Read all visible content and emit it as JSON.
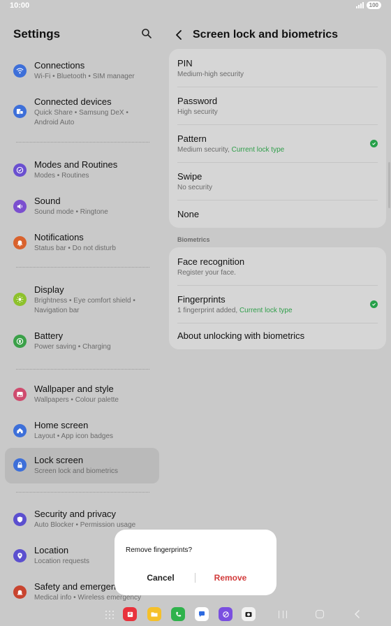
{
  "status_bar": {
    "time": "10:00",
    "battery": "100"
  },
  "left": {
    "title": "Settings",
    "items": [
      {
        "title": "Connections",
        "sub": "Wi-Fi  •  Bluetooth  •  SIM manager",
        "icon": "wifi-icon",
        "color": "#3d6fd9"
      },
      {
        "title": "Connected devices",
        "sub": "Quick Share  •  Samsung DeX  •",
        "sub2": "Android Auto",
        "icon": "devices-icon",
        "color": "#3d6fd9"
      },
      {
        "title": "Modes and Routines",
        "sub": "Modes  •  Routines",
        "icon": "routines-icon",
        "color": "#6a4fd0"
      },
      {
        "title": "Sound",
        "sub": "Sound mode  •  Ringtone",
        "icon": "sound-icon",
        "color": "#7b4fcf"
      },
      {
        "title": "Notifications",
        "sub": "Status bar  •  Do not disturb",
        "icon": "bell-icon",
        "color": "#d9622d"
      },
      {
        "title": "Display",
        "sub": "Brightness  •  Eye comfort shield  •",
        "sub2": "Navigation bar",
        "icon": "sun-icon",
        "color": "#8dc12b"
      },
      {
        "title": "Battery",
        "sub": "Power saving  •  Charging",
        "icon": "battery-icon",
        "color": "#3aa048"
      },
      {
        "title": "Wallpaper and style",
        "sub": "Wallpapers  •  Colour palette",
        "icon": "wallpaper-icon",
        "color": "#cf4b6e"
      },
      {
        "title": "Home screen",
        "sub": "Layout  •  App icon badges",
        "icon": "home-icon",
        "color": "#3d6fd9"
      },
      {
        "title": "Lock screen",
        "sub": "Screen lock and biometrics",
        "icon": "lock-icon",
        "color": "#3d6fd9"
      },
      {
        "title": "Security and privacy",
        "sub": "Auto Blocker  •  Permission usage",
        "icon": "shield-icon",
        "color": "#5b4fcf"
      },
      {
        "title": "Location",
        "sub": "Location requests",
        "icon": "location-icon",
        "color": "#5b4fcf"
      },
      {
        "title": "Safety and emergency",
        "sub": "Medical info  •  Wireless emergency",
        "icon": "emergency-icon",
        "color": "#c8442f"
      }
    ]
  },
  "right": {
    "title": "Screen lock and biometrics",
    "lock_types": [
      {
        "title": "PIN",
        "sub": "Medium-high security"
      },
      {
        "title": "Password",
        "sub": "High security"
      },
      {
        "title": "Pattern",
        "sub": "Medium security, ",
        "sub_green": "Current lock type"
      },
      {
        "title": "Swipe",
        "sub": "No security"
      },
      {
        "title": "None"
      }
    ],
    "biometrics_label": "Biometrics",
    "biometrics": [
      {
        "title": "Face recognition",
        "sub": "Register your face."
      },
      {
        "title": "Fingerprints",
        "sub": "1 fingerprint added, ",
        "sub_green": "Current lock type"
      },
      {
        "title": "About unlocking with biometrics"
      }
    ]
  },
  "dialog": {
    "title": "Remove fingerprints?",
    "cancel": "Cancel",
    "remove": "Remove"
  }
}
